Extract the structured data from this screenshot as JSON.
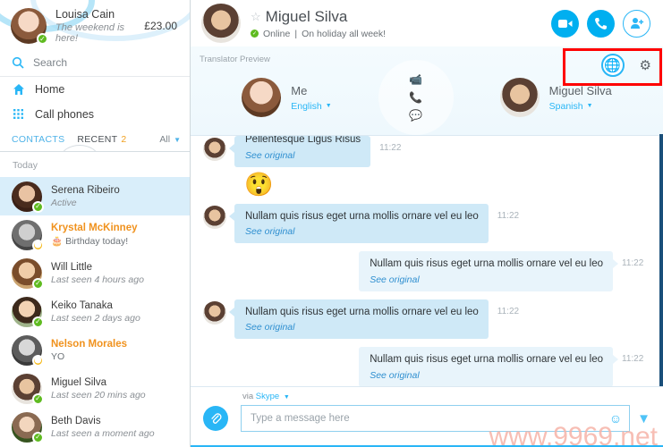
{
  "sidebar": {
    "me": {
      "name": "Louisa Cain",
      "mood": "The weekend is here!",
      "credit": "£23.00",
      "status_icon": "online-status-icon"
    },
    "search": {
      "placeholder": "Search",
      "icon": "search-icon"
    },
    "nav": [
      {
        "label": "Home",
        "icon": "home-icon"
      },
      {
        "label": "Call phones",
        "icon": "dialpad-icon"
      }
    ],
    "tabs": {
      "contacts": "CONTACTS",
      "recent": "RECENT",
      "recent_badge": "2",
      "filter": "All",
      "filter_icon": "chevron-down-icon"
    },
    "day_label": "Today",
    "contacts": [
      {
        "name": "Serena Ribeiro",
        "sub": "Active",
        "status": "online",
        "selected": true,
        "highlight": false,
        "italic": true,
        "face": "f-serena"
      },
      {
        "name": "Krystal McKinney",
        "sub": "Birthday today!",
        "status": "away",
        "selected": false,
        "highlight": true,
        "italic": false,
        "cake": true,
        "face": "f-krystal"
      },
      {
        "name": "Will Little",
        "sub": "Last seen 4 hours ago",
        "status": "online",
        "selected": false,
        "highlight": false,
        "italic": true,
        "face": "f-will"
      },
      {
        "name": "Keiko Tanaka",
        "sub": "Last seen 2 days ago",
        "status": "online",
        "selected": false,
        "highlight": false,
        "italic": true,
        "face": "f-keiko"
      },
      {
        "name": "Nelson Morales",
        "sub": "YO",
        "status": "away",
        "selected": false,
        "highlight": true,
        "italic": false,
        "face": "f-nelson"
      },
      {
        "name": "Miguel Silva",
        "sub": "Last seen 20 mins ago",
        "status": "online",
        "selected": false,
        "highlight": false,
        "italic": true,
        "face": "f-miguel"
      },
      {
        "name": "Beth Davis",
        "sub": "Last seen a moment ago",
        "status": "online",
        "selected": false,
        "highlight": false,
        "italic": true,
        "face": "f-beth"
      }
    ]
  },
  "chat_header": {
    "name": "Miguel Silva",
    "status": "Online",
    "separator": "|",
    "mood": "On holiday all week!",
    "star_icon": "star-icon",
    "buttons": [
      {
        "name": "video-call-button",
        "icon": "video-camera-icon"
      },
      {
        "name": "voice-call-button",
        "icon": "phone-icon"
      },
      {
        "name": "add-people-button",
        "icon": "add-person-icon"
      }
    ]
  },
  "translator": {
    "label": "Translator Preview",
    "globe_icon": "globe-icon",
    "gear_icon": "gear-icon",
    "left": {
      "name": "Me",
      "language": "English",
      "chevron": "chevron-down-icon"
    },
    "right": {
      "name": "Miguel Silva",
      "language": "Spanish",
      "chevron": "chevron-down-icon"
    },
    "center_icons": [
      "video-camera-icon",
      "phone-icon",
      "chat-bubble-icon"
    ]
  },
  "messages": [
    {
      "dir": "in",
      "text": "Pellentesque Ligus Risus",
      "see_original": "See original",
      "time": "11:22",
      "clipped": true
    },
    {
      "dir": "emoji",
      "glyph": "😲",
      "time": ""
    },
    {
      "dir": "in",
      "text": "Nullam quis risus eget urna mollis ornare vel eu leo",
      "see_original": "See original",
      "time": "11:22"
    },
    {
      "dir": "out",
      "text": "Nullam quis risus eget urna mollis ornare vel eu leo",
      "see_original": "See original",
      "time": "11:22"
    },
    {
      "dir": "in",
      "text": "Nullam quis risus eget urna mollis ornare vel eu leo",
      "see_original": "See original",
      "time": "11:22"
    },
    {
      "dir": "out",
      "text": "Nullam quis risus eget urna mollis ornare vel eu leo",
      "see_original": "See original",
      "time": "11:22"
    }
  ],
  "composer": {
    "via_prefix": "via",
    "via_service": "Skype",
    "via_chevron": "chevron-down-icon",
    "attach_icon": "paperclip-icon",
    "placeholder": "Type a message here",
    "emoji_icon": "emoji-icon",
    "send_icon": "send-icon"
  },
  "watermark": "www.9969.net",
  "colors": {
    "accent": "#00aff0",
    "link": "#29b6f6",
    "highlight_orange": "#f0921e",
    "online_green": "#5fbb20",
    "away_yellow": "#f5b917",
    "annotation_red": "#fe0000",
    "bubble_in": "#cfe9f7",
    "bubble_out": "#e8f4fb",
    "selected_row": "#d9eefa"
  }
}
